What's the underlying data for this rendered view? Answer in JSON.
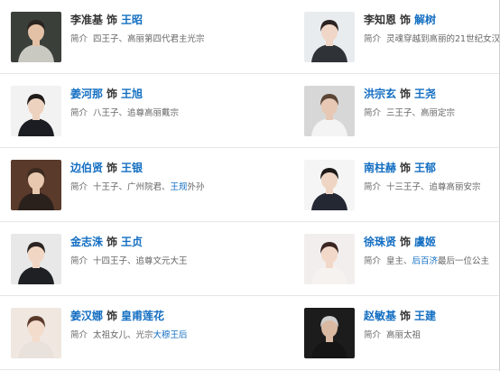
{
  "cast": [
    {
      "left": {
        "actor": "李准基",
        "actor_is_link": false,
        "as": "饰",
        "role": "王昭",
        "intro_label": "简介",
        "intro_pre": "四王子、高丽第四代君主光宗",
        "intro_link": "",
        "intro_post": "",
        "photo": {
          "bg": "#3a3f3a",
          "skin": "#e2c1a6",
          "hair": "#2a2420",
          "cloth": "#c9c9c2"
        }
      },
      "right": {
        "actor": "李知恩",
        "actor_is_link": false,
        "as": "饰",
        "role": "解树",
        "intro_label": "简介",
        "intro_pre": "灵魂穿越到高丽的21世纪女汉子",
        "intro_link": "",
        "intro_post": "",
        "photo": {
          "bg": "#e9ecef",
          "skin": "#f0d6c6",
          "hair": "#2b2222",
          "cloth": "#2f3338"
        }
      }
    },
    {
      "left": {
        "actor": "姜河那",
        "actor_is_link": true,
        "as": "饰",
        "role": "王旭",
        "intro_label": "简介",
        "intro_pre": "八王子、追尊高丽戴宗",
        "intro_link": "",
        "intro_post": "",
        "photo": {
          "bg": "#f2f2f2",
          "skin": "#ecd2bf",
          "hair": "#1f1b1a",
          "cloth": "#1c1d22"
        }
      },
      "right": {
        "actor": "洪宗玄",
        "actor_is_link": true,
        "as": "饰",
        "role": "王尧",
        "intro_label": "简介",
        "intro_pre": "三王子、高丽定宗",
        "intro_link": "",
        "intro_post": "",
        "photo": {
          "bg": "#d7d7d7",
          "skin": "#e6c8b4",
          "hair": "#5a4536",
          "cloth": "#f4f4f4"
        }
      }
    },
    {
      "left": {
        "actor": "边伯贤",
        "actor_is_link": true,
        "as": "饰",
        "role": "王银",
        "intro_label": "简介",
        "intro_pre": "十王子、广州院君、",
        "intro_link": "王规",
        "intro_post": "外孙",
        "photo": {
          "bg": "#5a3a2a",
          "skin": "#e8c9b0",
          "hair": "#3b2a20",
          "cloth": "#2a201c"
        }
      },
      "right": {
        "actor": "南柱赫",
        "actor_is_link": true,
        "as": "饰",
        "role": "王郁",
        "intro_label": "简介",
        "intro_pre": "十三王子、追尊高丽安宗",
        "intro_link": "",
        "intro_post": "",
        "photo": {
          "bg": "#f5f5f5",
          "skin": "#efd5c4",
          "hair": "#1e1a19",
          "cloth": "#242833"
        }
      }
    },
    {
      "left": {
        "actor": "金志洙",
        "actor_is_link": true,
        "as": "饰",
        "role": "王贞",
        "intro_label": "简介",
        "intro_pre": "十四王子、追尊文元大王",
        "intro_link": "",
        "intro_post": "",
        "photo": {
          "bg": "#e8e8e8",
          "skin": "#f1d6c3",
          "hair": "#2a2422",
          "cloth": "#1f2024"
        }
      },
      "right": {
        "actor": "徐珠贤",
        "actor_is_link": true,
        "as": "饰",
        "role": "虞姬",
        "intro_label": "简介",
        "intro_pre": "皇主、",
        "intro_link": "后百济",
        "intro_post": "最后一位公主",
        "photo": {
          "bg": "#f3eeee",
          "skin": "#f2d8c8",
          "hair": "#3a2622",
          "cloth": "#f6f2f0"
        }
      }
    },
    {
      "left": {
        "actor": "姜汉娜",
        "actor_is_link": true,
        "as": "饰",
        "role": "皇甫莲花",
        "intro_label": "简介",
        "intro_pre": "太祖女儿、光宗",
        "intro_link": "大穆王后",
        "intro_post": "",
        "photo": {
          "bg": "#efe7e0",
          "skin": "#f3dccb",
          "hair": "#5a3b2b",
          "cloth": "#e9e2dc"
        }
      },
      "right": {
        "actor": "赵敏基",
        "actor_is_link": true,
        "as": "饰",
        "role": "王建",
        "intro_label": "简介",
        "intro_pre": "高丽太祖",
        "intro_link": "",
        "intro_post": "",
        "photo": {
          "bg": "#1c1c1c",
          "skin": "#d9b9a2",
          "hair": "#cfcfcf",
          "cloth": "#151515"
        }
      }
    }
  ]
}
